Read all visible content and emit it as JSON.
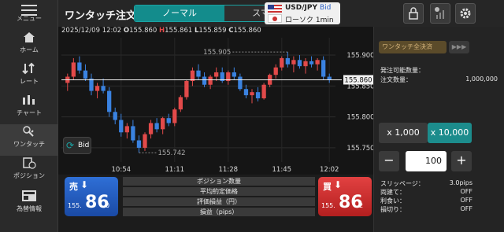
{
  "header": {
    "menu_label": "メニュー",
    "title": "ワンタッチ注文",
    "tabs": [
      {
        "label": "ノーマル",
        "active": true
      },
      {
        "label": "スマート",
        "active": false
      }
    ],
    "pair": "USD/JPY",
    "price_side": "Bid",
    "candle": "ローソク 1min"
  },
  "sidebar": {
    "items": [
      {
        "label": "ホーム",
        "icon": "home-icon"
      },
      {
        "label": "レート",
        "icon": "rate-icon"
      },
      {
        "label": "チャート",
        "icon": "chart-icon"
      },
      {
        "label": "ワンタッチ",
        "icon": "one-touch-icon",
        "active": true
      },
      {
        "label": "ポジション",
        "icon": "position-icon"
      },
      {
        "label": "為替情報",
        "icon": "news-icon"
      }
    ]
  },
  "chart_info": {
    "datetime": "2025/12/09 12:02",
    "o_label": "O",
    "o": "155.860",
    "h_label": "H",
    "h": "155.861",
    "l_label": "L",
    "l": "155.859",
    "c_label": "C",
    "c": "155.860"
  },
  "chart_data": {
    "type": "candlestick",
    "x_ticks": [
      "10:54",
      "11:11",
      "11:28",
      "11:45",
      "12:02"
    ],
    "y_ticks": [
      "155.900",
      "155.850",
      "155.800",
      "155.750"
    ],
    "ylim": [
      155.727,
      155.928
    ],
    "current_price": "155.860",
    "high_label": "155.905",
    "low_label": "155.742",
    "up_color": "#e24a4a",
    "down_color": "#3a82e0",
    "candles": [
      [
        155.855,
        155.87,
        155.842,
        155.865
      ],
      [
        155.865,
        155.895,
        155.86,
        155.888
      ],
      [
        155.888,
        155.898,
        155.87,
        155.875
      ],
      [
        155.875,
        155.885,
        155.858,
        155.862
      ],
      [
        155.862,
        155.87,
        155.835,
        155.842
      ],
      [
        155.842,
        155.855,
        155.83,
        155.85
      ],
      [
        155.85,
        155.862,
        155.838,
        155.842
      ],
      [
        155.842,
        155.848,
        155.8,
        155.808
      ],
      [
        155.808,
        155.815,
        155.788,
        155.795
      ],
      [
        155.795,
        155.805,
        155.768,
        155.775
      ],
      [
        155.775,
        155.79,
        155.765,
        155.785
      ],
      [
        155.785,
        155.795,
        155.758,
        155.762
      ],
      [
        155.762,
        155.77,
        155.742,
        155.75
      ],
      [
        155.75,
        155.775,
        155.745,
        155.772
      ],
      [
        155.772,
        155.795,
        155.765,
        155.79
      ],
      [
        155.79,
        155.798,
        155.775,
        155.78
      ],
      [
        155.78,
        155.8,
        155.772,
        155.798
      ],
      [
        155.798,
        155.805,
        155.785,
        155.79
      ],
      [
        155.79,
        155.815,
        155.785,
        155.812
      ],
      [
        155.812,
        155.835,
        155.808,
        155.832
      ],
      [
        155.832,
        155.86,
        155.828,
        155.858
      ],
      [
        155.858,
        155.88,
        155.85,
        155.875
      ],
      [
        155.875,
        155.885,
        155.86,
        155.865
      ],
      [
        155.865,
        155.872,
        155.848,
        155.852
      ],
      [
        155.852,
        155.868,
        155.845,
        155.865
      ],
      [
        155.865,
        155.88,
        155.858,
        155.872
      ],
      [
        155.872,
        155.88,
        155.855,
        155.858
      ],
      [
        155.858,
        155.875,
        155.852,
        155.872
      ],
      [
        155.872,
        155.88,
        155.86,
        155.865
      ],
      [
        155.865,
        155.87,
        155.842,
        155.845
      ],
      [
        155.845,
        155.852,
        155.83,
        155.835
      ],
      [
        155.835,
        155.845,
        155.822,
        155.84
      ],
      [
        155.84,
        155.848,
        155.825,
        155.83
      ],
      [
        155.83,
        155.855,
        155.828,
        155.852
      ],
      [
        155.852,
        155.87,
        155.848,
        155.868
      ],
      [
        155.868,
        155.885,
        155.862,
        155.88
      ],
      [
        155.88,
        155.898,
        155.875,
        155.895
      ],
      [
        155.895,
        155.905,
        155.88,
        155.885
      ],
      [
        155.885,
        155.898,
        155.872,
        155.892
      ],
      [
        155.892,
        155.9,
        155.878,
        155.882
      ],
      [
        155.882,
        155.895,
        155.87,
        155.89
      ],
      [
        155.89,
        155.898,
        155.88,
        155.885
      ],
      [
        155.885,
        155.895,
        155.875,
        155.892
      ],
      [
        155.892,
        155.898,
        155.86,
        155.865
      ],
      [
        155.865,
        155.87,
        155.855,
        155.86
      ]
    ]
  },
  "bid_button": "Bid",
  "sell": {
    "tag": "売",
    "price_small": "155.",
    "price_big": "86",
    "price_frac": "0"
  },
  "buy": {
    "tag": "買",
    "price_small": "155.",
    "price_big": "86",
    "price_frac": "2"
  },
  "position_rows": [
    "ポジション数量",
    "平均約定価格",
    "評価損益（円）",
    "損益（pips）"
  ],
  "right_panel": {
    "bulk_close": "ワンタッチ全決済",
    "bulk_arrow": "▶▶▶",
    "available_label": "発注可能数量：",
    "available_value": "",
    "order_qty_label": "注文数量：",
    "order_qty_value": "1,000,000",
    "lot_1": "x 1,000",
    "lot_10": "x 10,000",
    "qty_value": "100",
    "minus": "−",
    "plus": "+",
    "slippage_label": "スリッページ：",
    "slippage_value": "3.0pips",
    "rows": [
      {
        "label": "両建て：",
        "value": "OFF"
      },
      {
        "label": "利食い：",
        "value": "OFF"
      },
      {
        "label": "損切り：",
        "value": "OFF"
      }
    ]
  }
}
